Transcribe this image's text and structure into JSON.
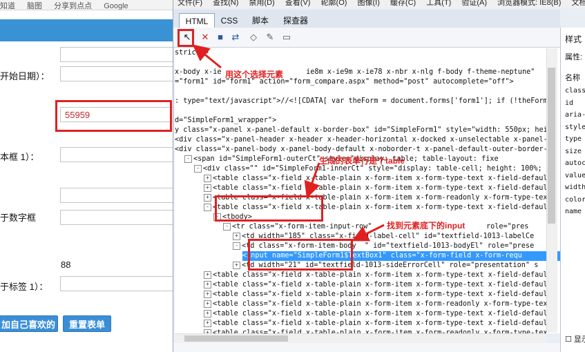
{
  "browser": {
    "bookmarks": [
      "知道",
      "脑图",
      "分享到点点",
      "Google"
    ],
    "form": {
      "labels": [
        "开始日期）：",
        "本框 1）：",
        "于数字框",
        "于标签 1）："
      ],
      "inputs": [
        {
          "value": ""
        },
        {
          "value": ""
        },
        {
          "value": "55959"
        },
        {
          "value": ""
        },
        {
          "value": ""
        },
        {
          "value": ""
        },
        {
          "value": ""
        }
      ],
      "number_value": "88",
      "buttons": {
        "add": "加自己喜欢的",
        "reset": "重置表单"
      }
    }
  },
  "devtools": {
    "menu": [
      "文件(F)",
      "查找(N)",
      "禁用(D)",
      "查看(V)",
      "轮廓(O)",
      "图像(I)",
      "缓存(C)",
      "工具(T)",
      "验证(A)",
      "浏览器模式: IE8(B)",
      "文档"
    ],
    "tabs": [
      "HTML",
      "CSS",
      "脚本",
      "探查器"
    ],
    "active_tab": "HTML",
    "tools": [
      "select-element-icon",
      "clear-icon",
      "save-icon",
      "refresh-icon",
      "source-icon",
      "edit-icon",
      "word-wrap-icon"
    ],
    "code_lines": [
      {
        "indent": 0,
        "exp": "",
        "parts": [
          [
            "t",
            "strict\">"
          ]
        ]
      },
      {
        "indent": 0,
        "exp": "",
        "parts": [
          [
            "t",
            "x-body x-ie                    ie8m x-ie9m x-ie78 x-nbr x-nlg f-body f-theme-neptune\""
          ]
        ]
      },
      {
        "indent": 0,
        "exp": "",
        "parts": [
          [
            "t",
            "=\"form1\" id=\"form1\" action=\"form_compare.aspx\" method=\"post\" autocomplete=\"off\">"
          ]
        ]
      },
      {
        "indent": 0,
        "exp": "",
        "parts": [
          [
            "t",
            ""
          ]
        ]
      },
      {
        "indent": 0,
        "exp": "",
        "parts": [
          [
            "t",
            ": type=\"text/javascript\">//<![CDATA[ var theForm = document.forms['form1']; if (!theForm)"
          ]
        ]
      },
      {
        "indent": 0,
        "exp": "",
        "parts": [
          [
            "t",
            ""
          ]
        ]
      },
      {
        "indent": 0,
        "exp": "",
        "parts": [
          [
            "t",
            "d=\"SimpleForm1_wrapper\">"
          ]
        ]
      },
      {
        "indent": 0,
        "exp": "",
        "parts": [
          [
            "t",
            "y class=\"x-panel x-panel-default x-border-box\" id=\"SimpleForm1\" style=\"width: 550px; hei"
          ]
        ]
      },
      {
        "indent": 0,
        "exp": "",
        "parts": [
          [
            "t",
            "<div class=\"x-panel-header x-header x-header-horizontal x-docked x-unselectable x-panel-"
          ]
        ]
      },
      {
        "indent": 0,
        "exp": "",
        "parts": [
          [
            "t",
            "<div class=\"x-panel-body x-panel-body-default x-noborder-t x-panel-default-outer-border-"
          ]
        ]
      },
      {
        "indent": 1,
        "exp": "-",
        "parts": [
          [
            "t",
            "<span id=\"SimpleForm1-outerCt\" style=\"display: table; table-layout: fixe"
          ]
        ]
      },
      {
        "indent": 2,
        "exp": "-",
        "parts": [
          [
            "t",
            "<div class=\"\" id=\"SimpleForm1-innerCt\" style=\"display: table-cell; height: 100%; v"
          ]
        ]
      },
      {
        "indent": 3,
        "exp": "+",
        "parts": [
          [
            "t",
            "<table class=\"x-field x-table-plain x-form-item x-form-type-text x-field-defaul"
          ]
        ]
      },
      {
        "indent": 3,
        "exp": "+",
        "parts": [
          [
            "t",
            "<table class=\"x-field x-table-plain x-form-item x-form-type-text x-field-defaul"
          ]
        ]
      },
      {
        "indent": 3,
        "exp": "+",
        "parts": [
          [
            "t",
            "<table class=\"x-field x-table-plain x-form-item x-form-readonly x-form-type-tex"
          ]
        ]
      },
      {
        "indent": 3,
        "exp": "-",
        "parts": [
          [
            "t",
            "<table class=\"x-field x-table-plain x-form-item x-form-type-text x-field-defaul"
          ]
        ]
      },
      {
        "indent": 4,
        "exp": "-",
        "parts": [
          [
            "t",
            "<tbody>"
          ]
        ]
      },
      {
        "indent": 5,
        "exp": "-",
        "parts": [
          [
            "t",
            "<tr class=\"x-form-item-input-row\"                           role=\"pres"
          ]
        ]
      },
      {
        "indent": 6,
        "exp": "+",
        "parts": [
          [
            "t",
            "<td width=\"185\" class=\"x-field-label-cell\" id=\"textfield-1013-labelCe"
          ]
        ]
      },
      {
        "indent": 6,
        "exp": "-",
        "parts": [
          [
            "t",
            "<td class=\"x-form-item-body  \" id=\"textfield-1013-bodyEl\" role=\"prese"
          ]
        ]
      },
      {
        "indent": 7,
        "exp": "",
        "sel": true,
        "parts": [
          [
            "t",
            "<input name=\"SimpleForm1$TextBox1\" class=\"x-form-field x-form-requ"
          ]
        ]
      },
      {
        "indent": 6,
        "exp": "+",
        "parts": [
          [
            "t",
            "<td width=\"21\" id=\"textfield-1013-sideErrorCell\" role=\"presentation\" s"
          ]
        ]
      },
      {
        "indent": 3,
        "exp": "+",
        "parts": [
          [
            "t",
            "<table class=\"x-field x-table-plain x-form-item x-form-type-text x-field-defaul"
          ]
        ]
      },
      {
        "indent": 3,
        "exp": "+",
        "parts": [
          [
            "t",
            "<table class=\"x-field x-table-plain x-form-item x-form-type-text x-field-defaul"
          ]
        ]
      },
      {
        "indent": 3,
        "exp": "+",
        "parts": [
          [
            "t",
            "<table class=\"x-field x-table-plain x-form-item x-form-type-text x-field-defaul"
          ]
        ]
      },
      {
        "indent": 3,
        "exp": "+",
        "parts": [
          [
            "t",
            "<table class=\"x-field x-table-plain x-form-item x-form-readonly x-form-type-tex"
          ]
        ]
      },
      {
        "indent": 3,
        "exp": "+",
        "parts": [
          [
            "t",
            "<table class=\"x-field x-table-plain x-form-item x-form-type-text x-field-defaul"
          ]
        ]
      },
      {
        "indent": 3,
        "exp": "+",
        "parts": [
          [
            "t",
            "<table class=\"x-field x-table-plain x-form-item x-form-type-text x-field-defaul"
          ]
        ]
      },
      {
        "indent": 3,
        "exp": "+",
        "parts": [
          [
            "t",
            "<table class=\"x-field x-table-plain x-form-item x-form-readonly x-form-type-tex"
          ]
        ]
      },
      {
        "indent": 3,
        "exp": "+",
        "parts": [
          [
            "t",
            "<table class=\"x-field x-table-plain x-form-item x-form-type-text x-field-defaul"
          ]
        ]
      }
    ],
    "style_pane": {
      "title": "样式",
      "attr_tab": "属性:",
      "name_header": "名称",
      "props": [
        "class",
        "id",
        "aria-",
        "style",
        "type",
        "size",
        "autoc",
        "value",
        "width",
        "color",
        "name"
      ],
      "show_checkbox": "显示"
    }
  },
  "annotations": {
    "select_element": "用这个选择元素",
    "table_row": "生成的表单行是个table",
    "find_input": "找到元素底下的input"
  },
  "colors": {
    "accent": "#3892d4",
    "highlight": "#e02020",
    "selection": "#3399ff"
  }
}
